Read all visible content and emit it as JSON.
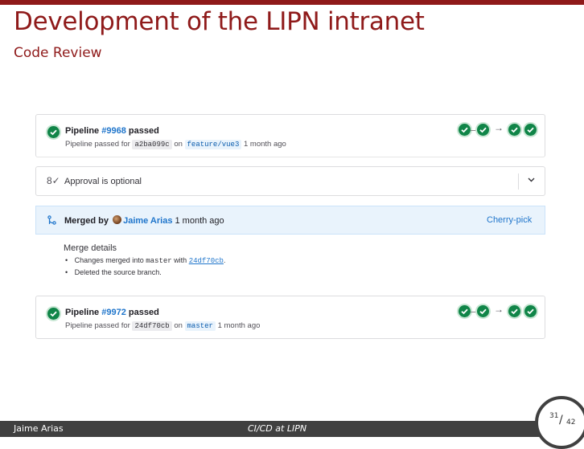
{
  "slide": {
    "title": "Development of the LIPN intranet",
    "subtitle": "Code Review"
  },
  "pipelines": [
    {
      "label_prefix": "Pipeline",
      "id": "#9968",
      "label_suffix": "passed",
      "sub_prefix": "Pipeline passed for",
      "commit": "a2ba099c",
      "on": "on",
      "branch": "feature/vue3",
      "age": "1 month ago"
    },
    {
      "label_prefix": "Pipeline",
      "id": "#9972",
      "label_suffix": "passed",
      "sub_prefix": "Pipeline passed for",
      "commit": "24df70cb",
      "on": "on",
      "branch": "master",
      "age": "1 month ago"
    }
  ],
  "stage_arrow": "→",
  "approval": {
    "icon": "approval-user-icon",
    "icon_glyph": "8✓",
    "text": "Approval is optional",
    "chevron": "⌄"
  },
  "merged": {
    "icon_glyph": "⑂",
    "merged_by": "Merged by",
    "author": "Jaime Arias",
    "age": "1 month ago",
    "cherry_pick": "Cherry-pick",
    "details_title": "Merge details",
    "item1_prefix": "Changes merged into",
    "item1_branch": "master",
    "item1_with": "with",
    "item1_commit": "24df70cb",
    "item1_end": ".",
    "item2": "Deleted the source branch."
  },
  "footer": {
    "author": "Jaime Arias",
    "title": "CI/CD at LIPN",
    "page": "31",
    "slash": "/",
    "total": "42"
  },
  "colors": {
    "accent": "#8f1a1a",
    "success": "#108548",
    "link": "#1f75cb",
    "footer_bg": "#404040"
  }
}
